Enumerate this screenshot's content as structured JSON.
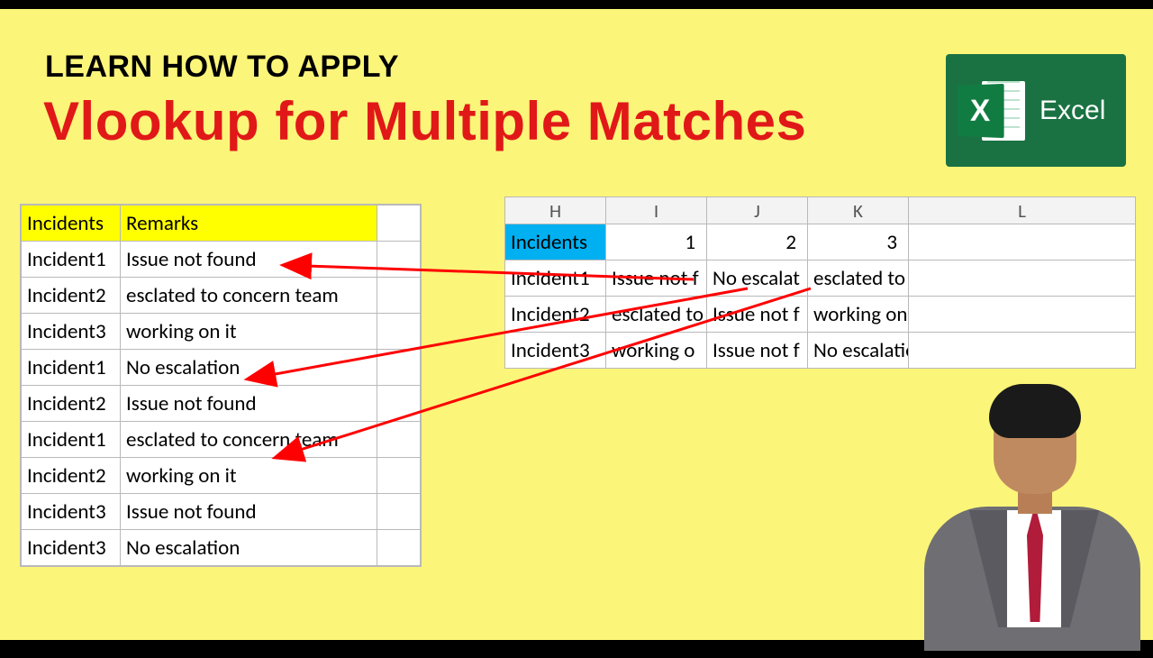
{
  "header": {
    "pretitle": "LEARN HOW TO APPLY",
    "title": "Vlookup for Multiple Matches",
    "excel_label": "Excel",
    "excel_x": "X"
  },
  "left_table": {
    "headers": [
      "Incidents",
      "Remarks"
    ],
    "rows": [
      [
        "Incident1",
        "Issue not found"
      ],
      [
        "Incident2",
        "esclated to concern team"
      ],
      [
        "Incident3",
        "working on it"
      ],
      [
        "Incident1",
        "No escalation"
      ],
      [
        "Incident2",
        "Issue not found"
      ],
      [
        "Incident1",
        "esclated to concern team"
      ],
      [
        "Incident2",
        "working on it"
      ],
      [
        "Incident3",
        "Issue not found"
      ],
      [
        "Incident3",
        "No escalation"
      ]
    ]
  },
  "right_table": {
    "col_letters": [
      "H",
      "I",
      "J",
      "K",
      "L"
    ],
    "header_row": {
      "label": "Incidents",
      "nums": [
        "1",
        "2",
        "3",
        ""
      ]
    },
    "rows": [
      {
        "inc": "Incident1",
        "cells": [
          "Issue not f",
          "No escalat",
          "esclated to concern team",
          ""
        ]
      },
      {
        "inc": "Incident2",
        "cells": [
          "esclated to",
          "Issue not f",
          "working on it",
          ""
        ]
      },
      {
        "inc": "Incident3",
        "cells": [
          "working o",
          "Issue not f",
          "No escalation",
          ""
        ]
      }
    ]
  }
}
